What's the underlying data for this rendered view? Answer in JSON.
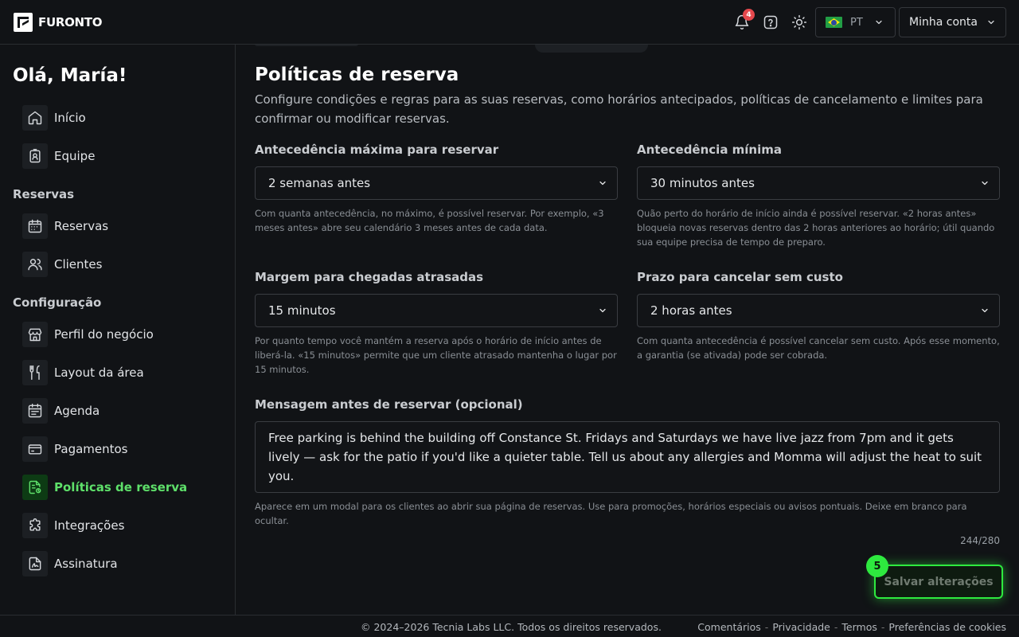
{
  "brand": {
    "name": "FURONTO"
  },
  "header": {
    "notifications_count": "4",
    "language_code": "PT",
    "account_label": "Minha conta"
  },
  "sidebar": {
    "greeting": "Olá, María!",
    "top_items": [
      {
        "label": "Início",
        "icon": "home-icon"
      },
      {
        "label": "Equipe",
        "icon": "badge-icon"
      }
    ],
    "sections": [
      {
        "title": "Reservas",
        "items": [
          {
            "label": "Reservas",
            "icon": "calendar-icon"
          },
          {
            "label": "Clientes",
            "icon": "users-icon"
          }
        ]
      },
      {
        "title": "Configuração",
        "items": [
          {
            "label": "Perfil do negócio",
            "icon": "store-icon"
          },
          {
            "label": "Layout da área",
            "icon": "utensils-icon"
          },
          {
            "label": "Agenda",
            "icon": "agenda-icon"
          },
          {
            "label": "Pagamentos",
            "icon": "wallet-icon"
          },
          {
            "label": "Políticas de reserva",
            "icon": "policy-icon",
            "active": true
          },
          {
            "label": "Integrações",
            "icon": "puzzle-icon"
          },
          {
            "label": "Assinatura",
            "icon": "signature-icon"
          }
        ]
      }
    ]
  },
  "main": {
    "title": "Políticas de reserva",
    "description": "Configure condições e regras para as suas reservas, como horários antecipados, políticas de cancelamento e limites para confirmar ou modificar reservas.",
    "fields": {
      "max_advance": {
        "label": "Antecedência máxima para reservar",
        "value": "2 semanas antes",
        "help": "Com quanta antecedência, no máximo, é possível reservar. Por exemplo, «3 meses antes» abre seu calendário 3 meses antes de cada data."
      },
      "min_advance": {
        "label": "Antecedência mínima",
        "value": "30 minutos antes",
        "help": "Quão perto do horário de início ainda é possível reservar. «2 horas antes» bloqueia novas reservas dentro das 2 horas anteriores ao horário; útil quando sua equipe precisa de tempo de preparo."
      },
      "late_arrival": {
        "label": "Margem para chegadas atrasadas",
        "value": "15 minutos",
        "help": "Por quanto tempo você mantém a reserva após o horário de início antes de liberá-la. «15 minutos» permite que um cliente atrasado mantenha o lugar por 15 minutos."
      },
      "free_cancel": {
        "label": "Prazo para cancelar sem custo",
        "value": "2 horas antes",
        "help": "Com quanta antecedência é possível cancelar sem custo. Após esse momento, a garantia (se ativada) pode ser cobrada."
      },
      "message": {
        "label": "Mensagem antes de reservar (opcional)",
        "value": "Free parking is behind the building off Constance St. Fridays and Saturdays we have live jazz from 7pm and it gets lively — ask for the patio if you'd like a quieter table. Tell us about any allergies and Momma will adjust the heat to suit you.",
        "help": "Aparece em um modal para os clientes ao abrir sua página de reservas. Use para promoções, horários especiais ou avisos pontuais. Deixe em branco para ocultar.",
        "counter": "244/280"
      }
    },
    "save_label": "Salvar alterações",
    "save_step": "5"
  },
  "footer": {
    "copyright": "© 2024–2026 Tecnia Labs LLC. Todos os direitos reservados.",
    "links": [
      "Comentários",
      "Privacidade",
      "Termos",
      "Preferências de cookies"
    ],
    "separator": "-"
  },
  "colors": {
    "accent": "#2ee93f",
    "active_text": "#5ee06a",
    "background": "#111316",
    "badge": "#e5484d"
  }
}
